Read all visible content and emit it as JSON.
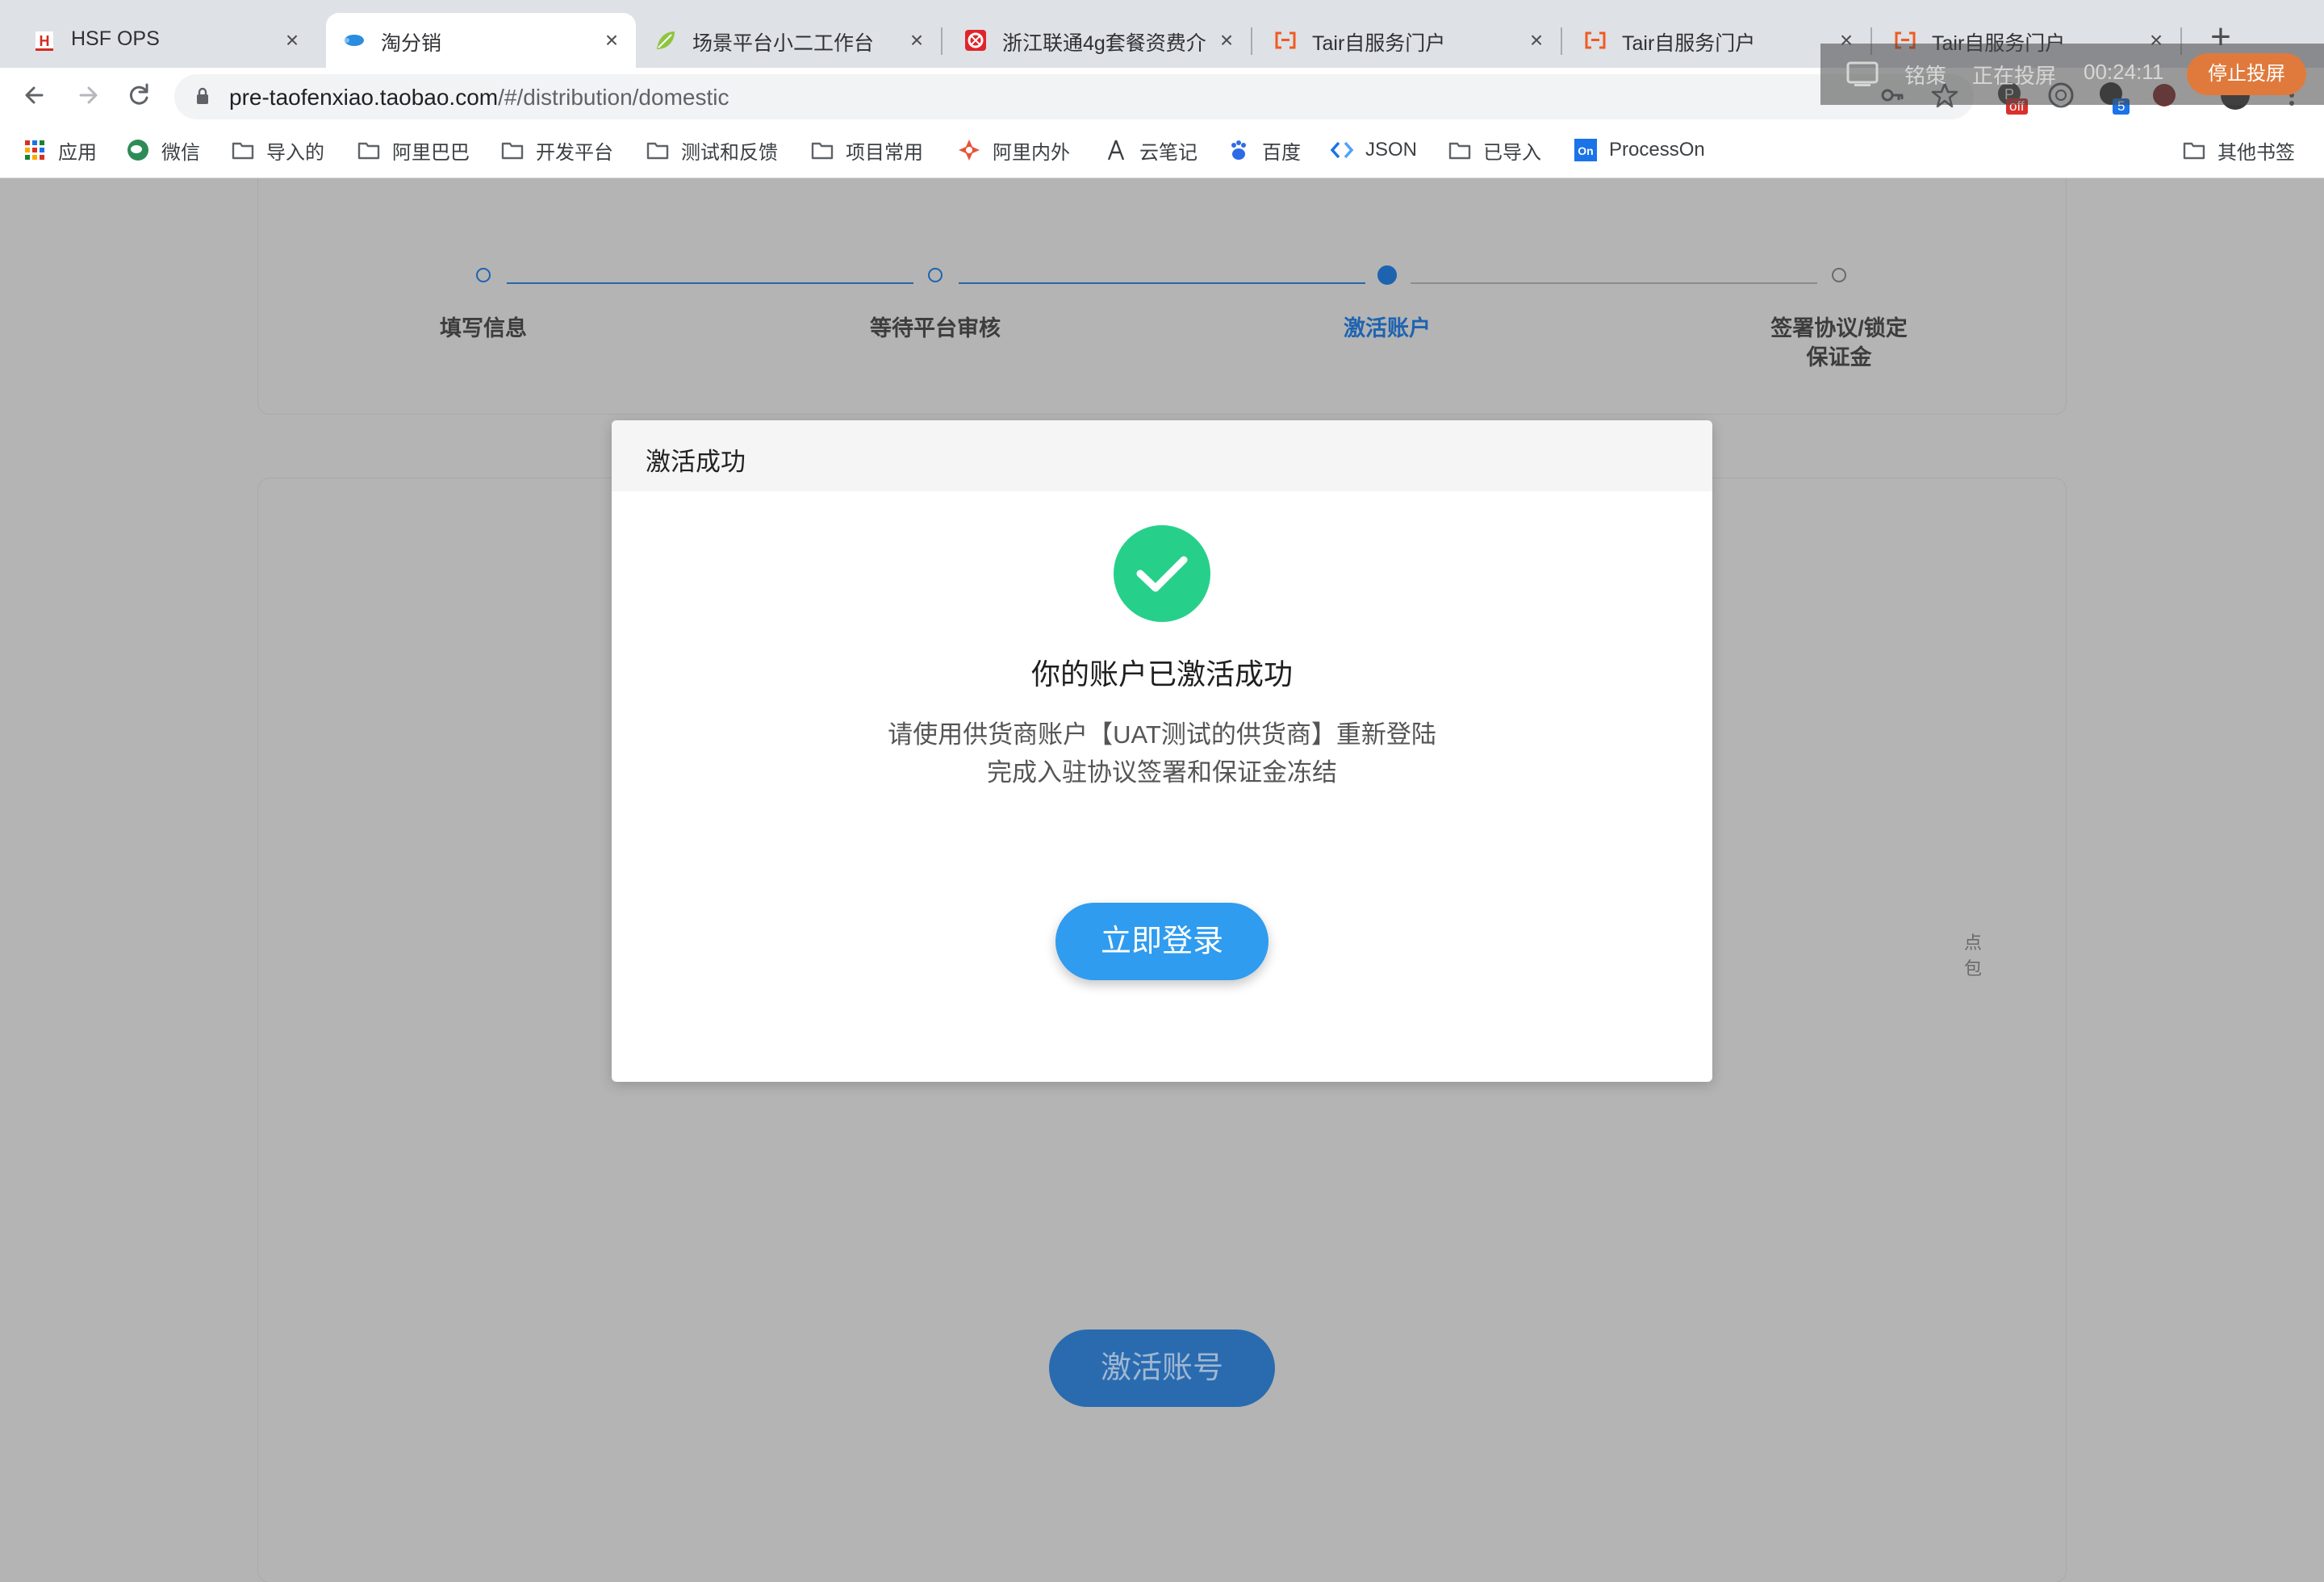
{
  "browser": {
    "tabs": [
      {
        "title": "HSF OPS",
        "active": false
      },
      {
        "title": "淘分销",
        "active": true
      },
      {
        "title": "场景平台小二工作台",
        "active": false
      },
      {
        "title": "浙江联通4g套餐资费介",
        "active": false
      },
      {
        "title": "Tair自服务门户",
        "active": false
      },
      {
        "title": "Tair自服务门户",
        "active": false
      },
      {
        "title": "Tair自服务门户",
        "active": false
      }
    ],
    "new_tab_glyph": "+",
    "close_glyph": "×",
    "url_host": "pre-taofenxiao.taobao.com",
    "url_path": "/#/distribution/domestic",
    "bookmarks": [
      {
        "label": "应用",
        "icon": "apps-grid-icon"
      },
      {
        "label": "微信",
        "icon": "wechat-icon"
      },
      {
        "label": "导入的",
        "icon": "folder-icon"
      },
      {
        "label": "阿里巴巴",
        "icon": "folder-icon"
      },
      {
        "label": "开发平台",
        "icon": "folder-icon"
      },
      {
        "label": "测试和反馈",
        "icon": "folder-icon"
      },
      {
        "label": "项目常用",
        "icon": "folder-icon"
      },
      {
        "label": "阿里内外",
        "icon": "alibaba-inner-icon"
      },
      {
        "label": "云笔记",
        "icon": "yunbiji-icon"
      },
      {
        "label": "百度",
        "icon": "baidu-icon"
      },
      {
        "label": "JSON",
        "icon": "json-icon"
      },
      {
        "label": "已导入",
        "icon": "folder-icon"
      },
      {
        "label": "ProcessOn",
        "icon": "processon-icon"
      }
    ],
    "other_bookmarks": "其他书签",
    "ext_badge_off": "off",
    "ext_badge_count": "5"
  },
  "cast": {
    "user": "铭策",
    "status": "正在投屏",
    "timer": "00:24:11",
    "stop_label": "停止投屏"
  },
  "steps": [
    {
      "label_line1": "填写信息",
      "label_line2": "",
      "state": "done"
    },
    {
      "label_line1": "等待平台审核",
      "label_line2": "",
      "state": "done"
    },
    {
      "label_line1": "激活账户",
      "label_line2": "",
      "state": "current"
    },
    {
      "label_line1": "签署协议/锁定",
      "label_line2": "保证金",
      "state": "todo"
    }
  ],
  "background_hint": {
    "line1": "点",
    "line2": "包"
  },
  "activate_button_label": "激活账号",
  "modal": {
    "title": "激活成功",
    "message": "你的账户已激活成功",
    "desc_line1": "请使用供货商账户【UAT测试的供货商】重新登陆",
    "desc_line2": "完成入驻协议签署和保证金冻结",
    "login_button": "立即登录",
    "icon": "check-circle-icon",
    "icon_color": "#27d08a"
  },
  "colors": {
    "accent": "#2f9cf0",
    "step_blue": "#1e63b0",
    "overlay": "#b4b4b4"
  }
}
